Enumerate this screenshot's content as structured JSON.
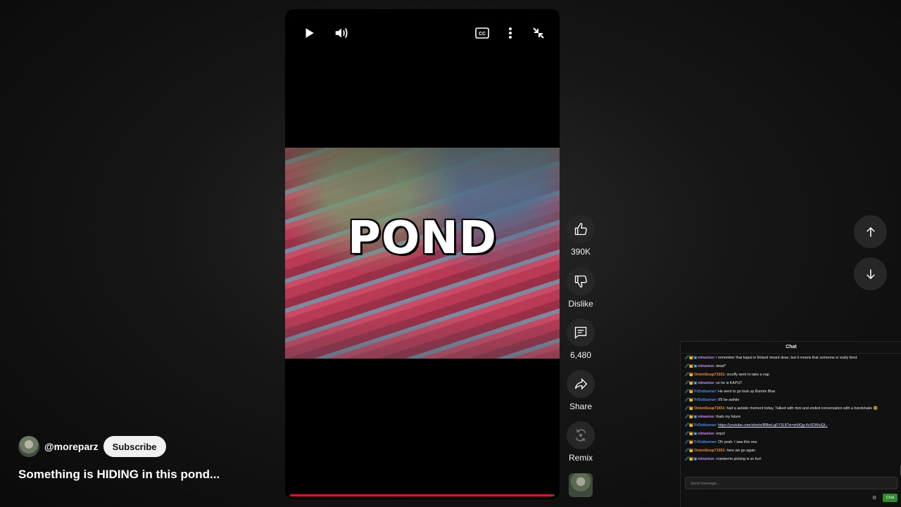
{
  "player": {
    "overlay_text": "POND",
    "progress_fraction": 0.99,
    "icons": [
      "play-icon",
      "volume-icon",
      "captions-icon",
      "more-vert-icon",
      "exit-fullscreen-icon"
    ]
  },
  "actions": {
    "like_count": "390K",
    "dislike_label": "Dislike",
    "comments_count": "6,480",
    "share_label": "Share",
    "remix_label": "Remix"
  },
  "channel": {
    "handle": "@moreparz",
    "subscribe_label": "Subscribe"
  },
  "video": {
    "title": "Something is HIDING in this pond..."
  },
  "chat": {
    "title": "Chat",
    "messages": [
      {
        "user": "niinanise",
        "color": "#c58af0",
        "badges": "🖉👑▣",
        "text": ": i remember that kaput in finland meant dese, but it means that someone is really tired."
      },
      {
        "user": "niinanise",
        "color": "#c58af0",
        "badges": "🖉👑▣",
        "text": ": dead*"
      },
      {
        "user": "OnionSoup71551",
        "color": "#f0913a",
        "badges": "🖉👑",
        "text": ": scruffy went to take a nap"
      },
      {
        "user": "niinanise",
        "color": "#c58af0",
        "badges": "🖉👑▣",
        "text": ": so he is KAPUT"
      },
      {
        "user": "FrOstburner",
        "color": "#4a90f0",
        "badges": "🖉👑",
        "text": ": He went to go look up Bonnie Blue"
      },
      {
        "user": "FrOstburner",
        "color": "#4a90f0",
        "badges": "🖉👑",
        "text": ": It'll be awhile"
      },
      {
        "user": "OnionSoup71551",
        "color": "#f0913a",
        "badges": "🖉👑",
        "text": ": had a autistic moment today. Talked with mini and ended conversation with a handshake 🤓"
      },
      {
        "user": "niinanise",
        "color": "#c58af0",
        "badges": "🖉👑▣",
        "text": ": thats my future"
      },
      {
        "user": "FrOstburner",
        "color": "#4a90f0",
        "badges": "🖉👑",
        "text": ": ",
        "link": "https://youtube.com/shorts/B8beLgFY3L8?si=sh9Qg-4zXDWulQL-"
      },
      {
        "user": "niinanise",
        "color": "#c58af0",
        "badges": "🖉👑▣",
        "text": ": oops!"
      },
      {
        "user": "FrOstburner",
        "color": "#4a90f0",
        "badges": "🖉👑",
        "text": ": Oh yeah. I saw this one"
      },
      {
        "user": "OnionSoup71551",
        "color": "#f0913a",
        "badges": "🖉👑",
        "text": ": here we go again"
      },
      {
        "user": "niinanise",
        "color": "#c58af0",
        "badges": "🖉👑▣",
        "text": ": cranberrie picking is so fun!"
      }
    ],
    "input_placeholder": "Send message...",
    "send_label": "Chat"
  }
}
